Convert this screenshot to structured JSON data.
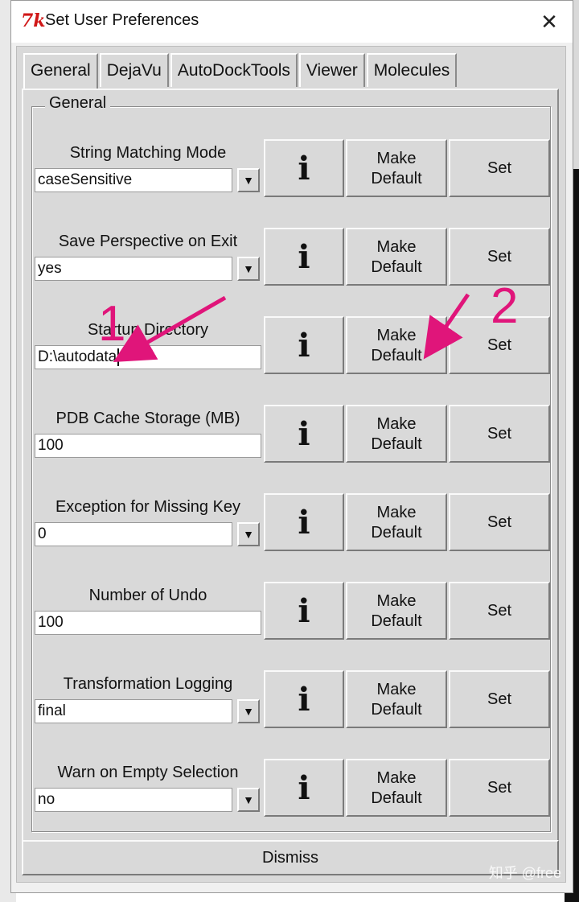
{
  "window": {
    "title": "Set User Preferences",
    "close_glyph": "✕",
    "icon_text": "7k"
  },
  "tabs": [
    {
      "label": "General",
      "active": true
    },
    {
      "label": "DejaVu",
      "active": false
    },
    {
      "label": "AutoDockTools",
      "active": false
    },
    {
      "label": "Viewer",
      "active": false
    },
    {
      "label": "Molecules",
      "active": false
    }
  ],
  "group": {
    "label": "General"
  },
  "rows": [
    {
      "label": "String Matching Mode",
      "value": "caseSensitive",
      "dropdown": true
    },
    {
      "label": "Save Perspective on Exit",
      "value": "yes",
      "dropdown": true
    },
    {
      "label": "Startup Directory",
      "value": "D:\\autodata",
      "dropdown": false
    },
    {
      "label": "PDB Cache Storage (MB)",
      "value": "100",
      "dropdown": false
    },
    {
      "label": "Exception for Missing Key",
      "value": "0",
      "dropdown": true
    },
    {
      "label": "Number of Undo",
      "value": "100",
      "dropdown": false
    },
    {
      "label": "Transformation Logging",
      "value": "final",
      "dropdown": true
    },
    {
      "label": "Warn on Empty Selection",
      "value": "no",
      "dropdown": true
    }
  ],
  "buttons": {
    "info_glyph": "i",
    "make_default_line1": "Make",
    "make_default_line2": "Default",
    "set_label": "Set",
    "dropdown_glyph": "▼",
    "dismiss_label": "Dismiss"
  },
  "annotations": {
    "marker_1": "1",
    "marker_2": "2",
    "color": "#e0157a"
  },
  "watermark": "知乎 @free"
}
